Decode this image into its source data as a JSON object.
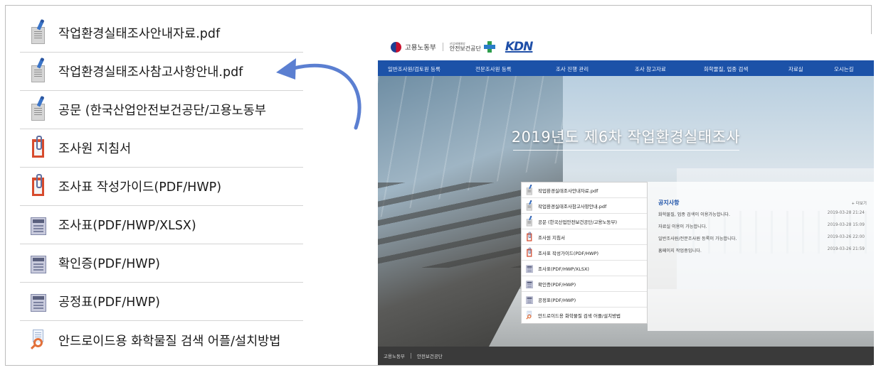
{
  "zoom_list": {
    "items": [
      {
        "label": "작업환경실태조사안내자료.pdf",
        "icon": "pdf-document-icon"
      },
      {
        "label": "작업환경실태조사참고사항안내.pdf",
        "icon": "pdf-document-icon"
      },
      {
        "label": "공문 (한국산업안전보건공단/고용노동부",
        "icon": "pdf-document-icon"
      },
      {
        "label": "조사원 지침서",
        "icon": "clipboard-icon"
      },
      {
        "label": "조사표 작성가이드(PDF/HWP)",
        "icon": "clipboard-icon"
      },
      {
        "label": "조사표(PDF/HWP/XLSX)",
        "icon": "form-document-icon"
      },
      {
        "label": "확인증(PDF/HWP)",
        "icon": "form-document-icon"
      },
      {
        "label": "공정표(PDF/HWP)",
        "icon": "form-document-icon"
      },
      {
        "label": "안드로이드용 화학물질 검색 어플/설치방법",
        "icon": "search-document-icon"
      }
    ]
  },
  "site": {
    "header": {
      "gov_name": "고용노동부",
      "kosha_small": "산업재해예방",
      "kosha_name": "안전보건공단",
      "kdn_logo": "KDN"
    },
    "nav": [
      "일반조사원/검토원 등록",
      "전문조사원 등록",
      "조사 진행 관리",
      "조사 참고자료",
      "화학물질, 업종 검색",
      "자료실",
      "오시는길"
    ],
    "hero_title": "2019년도 제6차 작업환경실태조사",
    "mini_list": [
      "작업환경실태조사안내자료.pdf",
      "작업환경실태조사참고사항안내.pdf",
      "공문 (한국산업안전보건공단/고용노동부)",
      "조사원 지침서",
      "조사표 작성가이드(PDF/HWP)",
      "조사표(PDF/HWP/XLSX)",
      "확인증(PDF/HWP)",
      "공정표(PDF/HWP)",
      "안드로이드용 화학물질 검색 어플/설치방법"
    ],
    "notice": {
      "title": "공지사항",
      "more": "+ 더보기",
      "rows": [
        {
          "text": "화학물질, 업종 검색이 이용가능합니다.",
          "date": "2019-03-28 21:24"
        },
        {
          "text": "자료실 이용이 가능합니다.",
          "date": "2019-03-28 15:09"
        },
        {
          "text": "일반조사원/전문조사원 등록이 가능합니다.",
          "date": "2019-03-26 22:00"
        },
        {
          "text": "홈페이지 작업중입니다.",
          "date": "2019-03-26 21:59"
        }
      ]
    },
    "footer": {
      "left": "고용노동부",
      "right": "안전보건공단"
    }
  },
  "colors": {
    "nav_bg": "#1c52a8",
    "arrow": "#5b7fd1",
    "footer_bg": "#3a3a3a"
  }
}
